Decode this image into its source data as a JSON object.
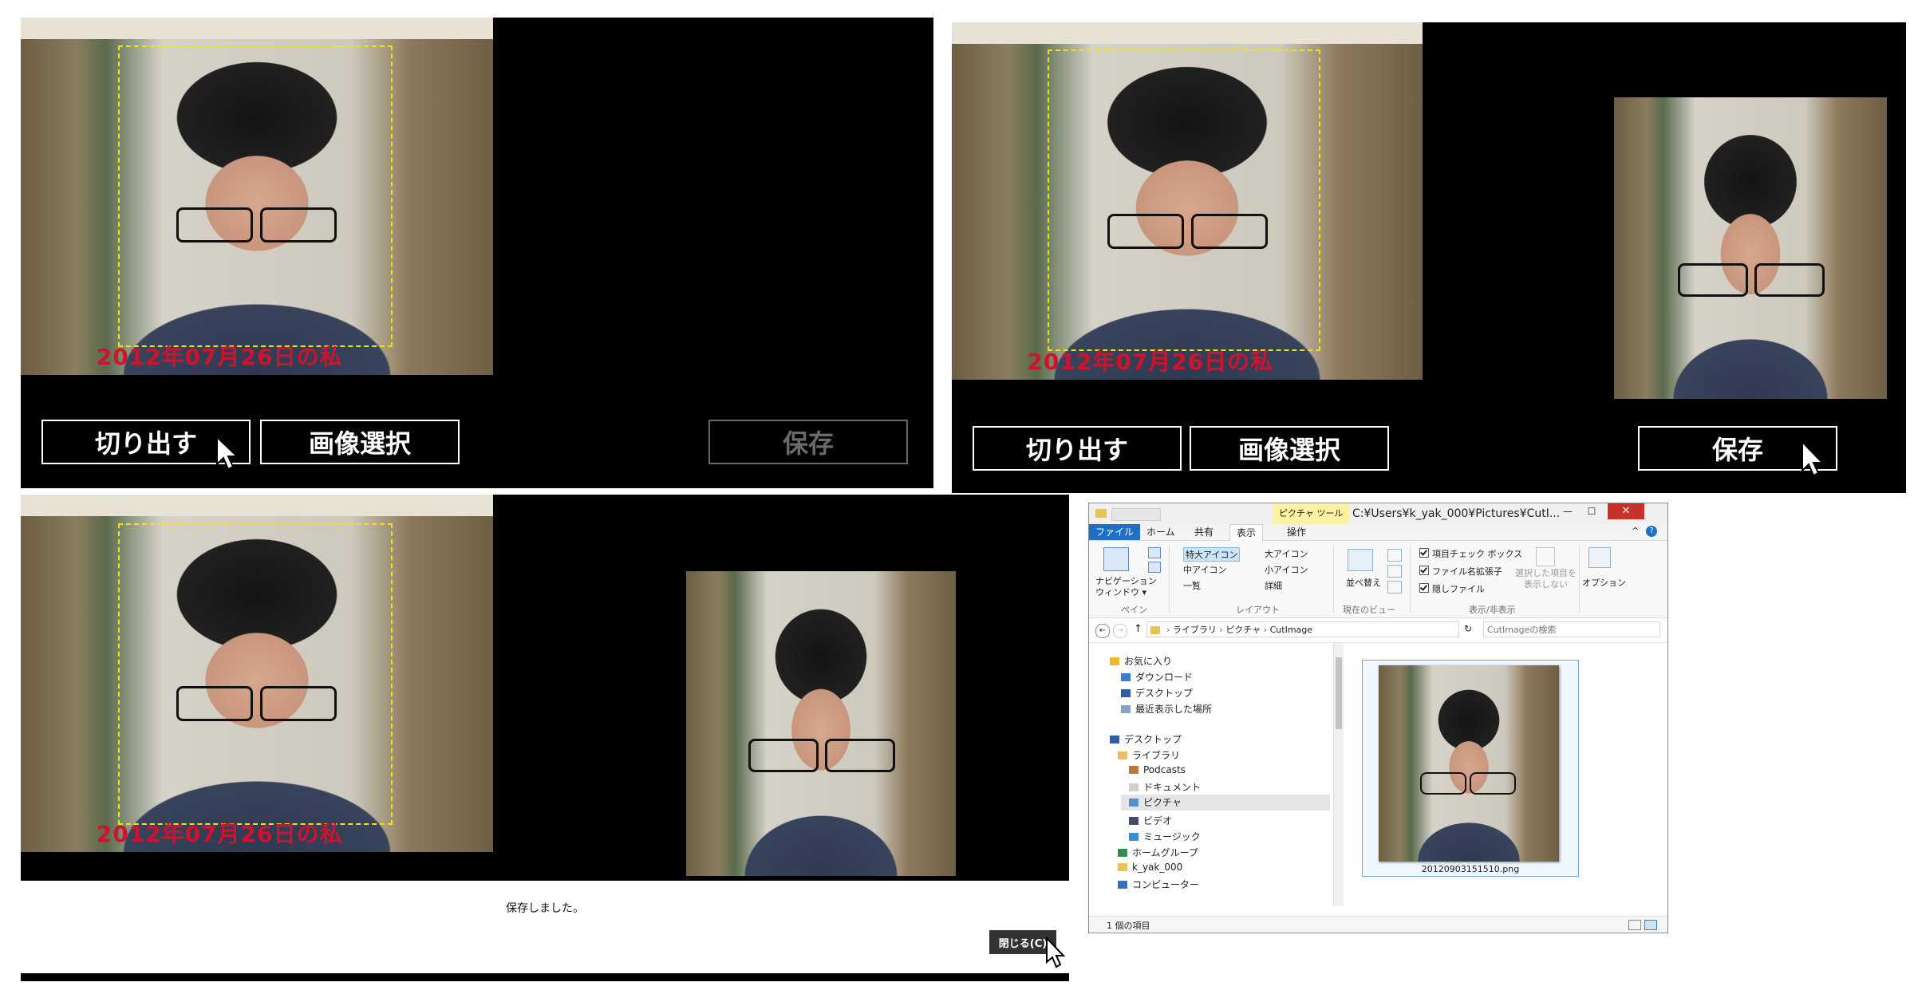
{
  "photo_caption": "2012年07月26日の私",
  "buttons": {
    "cut": "切り出す",
    "select_image": "画像選択",
    "save": "保存"
  },
  "dialog": {
    "message": "保存しました。",
    "close": "閉じる(C)"
  },
  "explorer": {
    "title_context_tab": "ピクチャ ツール",
    "title_path": "C:¥Users¥k_yak_000¥Pictures¥CutI...",
    "tabs": [
      "ファイル",
      "ホーム",
      "共有",
      "表示",
      "操作"
    ],
    "ribbon": {
      "nav_pane": "ナビゲーション\nウィンドウ ▾",
      "layout_items": [
        "特大アイコン",
        "大アイコン",
        "中アイコン",
        "小アイコン",
        "一覧",
        "詳細"
      ],
      "sort": "並べ替え",
      "checkboxes": [
        "項目チェック ボックス",
        "ファイル名拡張子",
        "隠しファイル"
      ],
      "hide_selected": "選択した項目を\n表示しない",
      "options": "オプション",
      "groups": [
        "ペイン",
        "レイアウト",
        "現在のビュー",
        "表示/非表示"
      ]
    },
    "breadcrumb": [
      "ライブラリ",
      "ピクチャ",
      "CutImage"
    ],
    "search_placeholder": "CutImageの検索",
    "nav_items": [
      "お気に入り",
      "ダウンロード",
      "デスクトップ",
      "最近表示した場所",
      "デスクトップ",
      "ライブラリ",
      "Podcasts",
      "ドキュメント",
      "ピクチャ",
      "ビデオ",
      "ミュージック",
      "ホームグループ",
      "k_yak_000",
      "コンピューター"
    ],
    "file_name": "20120903151510.png",
    "status": "1 個の項目"
  }
}
